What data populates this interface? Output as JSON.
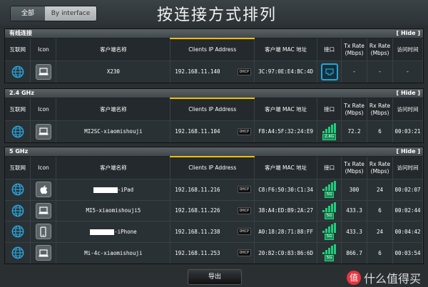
{
  "header": {
    "tab_all": "全部",
    "tab_by_interface": "By interface",
    "title": "按连接方式排列"
  },
  "columns": {
    "interface": "互联网",
    "icon": "Icon",
    "client_name": "客户端名称",
    "ip": "Clients IP Address",
    "mac": "客户端 MAC 地址",
    "port": "接口",
    "tx": "Tx Rate (Mbps)",
    "rx": "Rx Rate (Mbps)",
    "time": "访问时间"
  },
  "dhcp_label": "DHCP",
  "hide_label": "[ Hide ]",
  "sections": [
    {
      "title": "有线连接",
      "rows": [
        {
          "name": "X230",
          "ip": "192.168.11.140",
          "mac": "3C:97:0E:E4:BC:4D",
          "tx": "-",
          "rx": "-",
          "time": "-",
          "device": "laptop",
          "port": "lan"
        }
      ]
    },
    {
      "title": "2.4 GHz",
      "rows": [
        {
          "name": "MI2SC-xiaomishouji",
          "ip": "192.168.11.104",
          "mac": "F8:A4:5F:32:24:E9",
          "tx": "72.2",
          "rx": "6",
          "time": "00:03:21",
          "device": "laptop",
          "port": "2.4G"
        }
      ]
    },
    {
      "title": "5 GHz",
      "rows": [
        {
          "name": "-iPad",
          "ip": "192.168.11.216",
          "mac": "C8:F6:50:30:C1:34",
          "tx": "300",
          "rx": "24",
          "time": "00:02:07",
          "device": "apple",
          "port": "5G",
          "redacted": true
        },
        {
          "name": "MI5-xiaomishouji5",
          "ip": "192.168.11.226",
          "mac": "38:A4:ED:B9:2A:27",
          "tx": "433.3",
          "rx": "6",
          "time": "00:02:44",
          "device": "laptop",
          "port": "5G"
        },
        {
          "name": "-iPhone",
          "ip": "192.168.11.238",
          "mac": "A0:18:28:71:88:FF",
          "tx": "433.3",
          "rx": "24",
          "time": "00:04:42",
          "device": "phone",
          "port": "5G",
          "redacted": true
        },
        {
          "name": "Mi-4c-xiaomishouji",
          "ip": "192.168.11.253",
          "mac": "20:82:C0:83:86:6D",
          "tx": "866.7",
          "rx": "6",
          "time": "00:03:54",
          "device": "laptop",
          "port": "5G"
        }
      ]
    }
  ],
  "export_label": "导出",
  "watermark": {
    "badge": "值",
    "text": "什么值得买"
  }
}
